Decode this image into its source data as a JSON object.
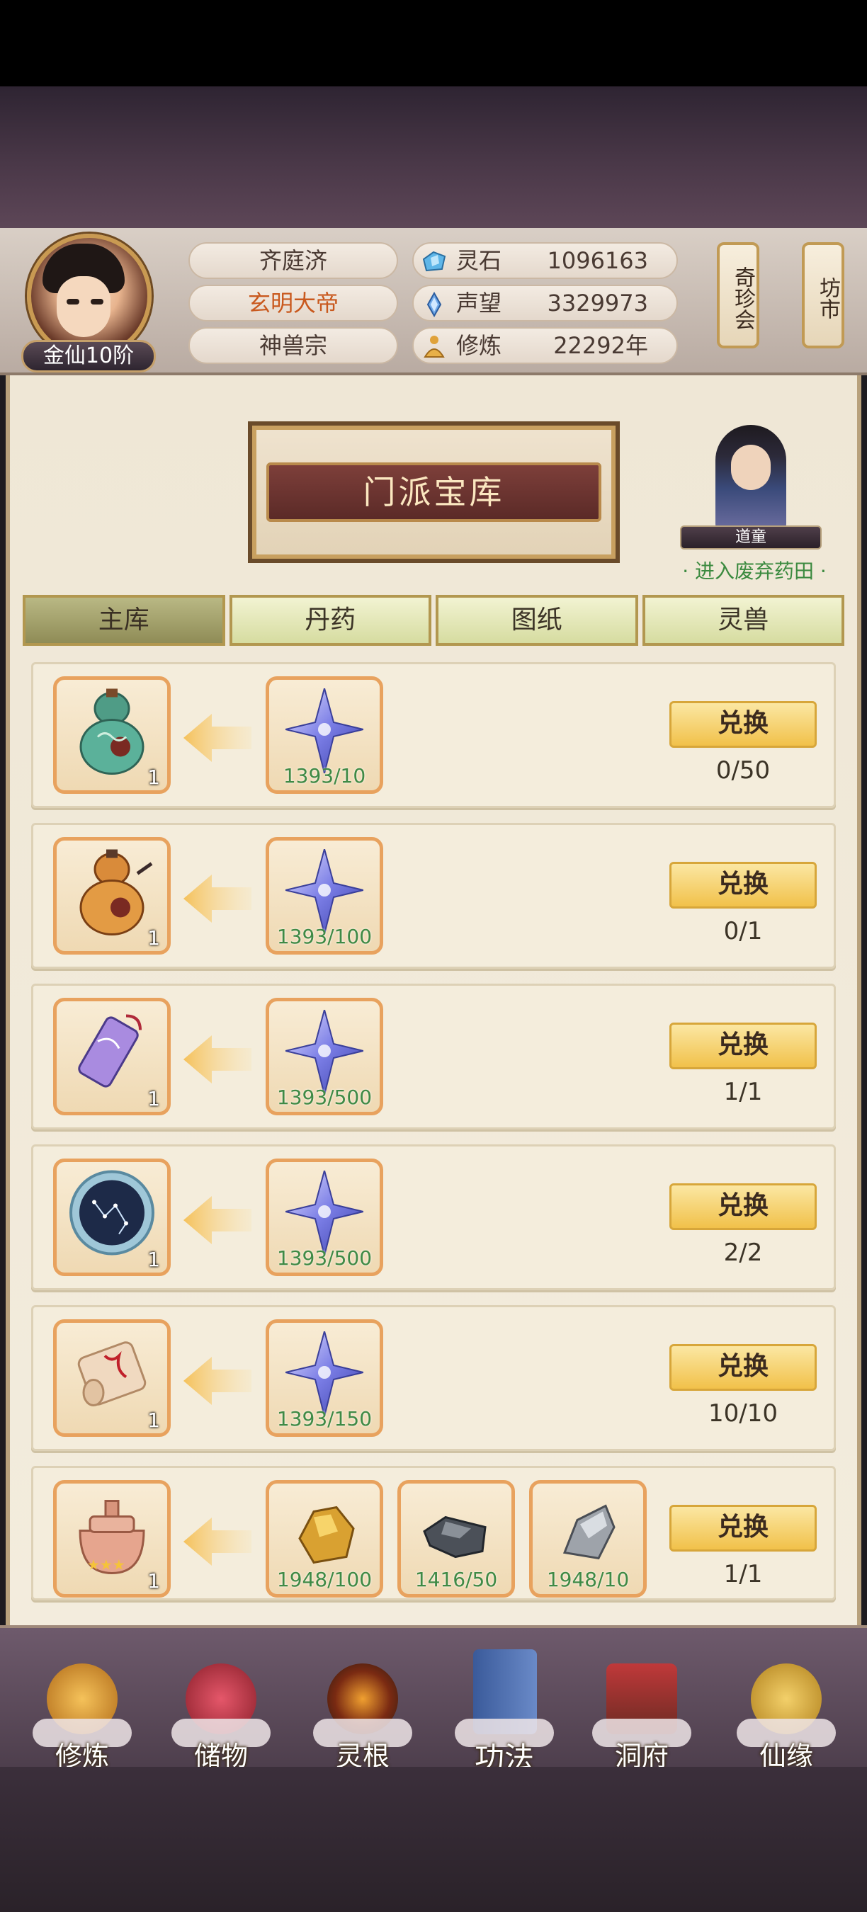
{
  "player": {
    "rank": "金仙10阶",
    "name": "齐庭济",
    "title": "玄明大帝",
    "sect": "神兽宗"
  },
  "resources": [
    {
      "icon": "spirit-stone-icon",
      "label": "灵石",
      "value": "1096163"
    },
    {
      "icon": "prestige-icon",
      "label": "声望",
      "value": "3329973"
    },
    {
      "icon": "cultivation-icon",
      "label": "修炼",
      "value": "22292年"
    }
  ],
  "side_buttons": {
    "treasure_fair": "奇珍会",
    "market": "坊市"
  },
  "page": {
    "title": "门派宝库",
    "npc_name": "道童",
    "npc_link": "· 进入废弃药田 ·"
  },
  "tabs": [
    "主库",
    "丹药",
    "图纸",
    "灵兽"
  ],
  "rows": [
    {
      "reward": "green-gourd-icon",
      "reward_count": "1",
      "costs": [
        {
          "icon": "purple-star-shard-icon",
          "qty": "1393/10"
        }
      ],
      "button": "兑换",
      "progress": "0/50"
    },
    {
      "reward": "orange-gourd-icon",
      "reward_count": "1",
      "costs": [
        {
          "icon": "purple-star-shard-icon",
          "qty": "1393/100"
        }
      ],
      "button": "兑换",
      "progress": "0/1"
    },
    {
      "reward": "purple-talisman-icon",
      "reward_count": "1",
      "costs": [
        {
          "icon": "purple-star-shard-icon",
          "qty": "1393/500"
        }
      ],
      "button": "兑换",
      "progress": "1/1"
    },
    {
      "reward": "star-chart-icon",
      "reward_count": "1",
      "costs": [
        {
          "icon": "purple-star-shard-icon",
          "qty": "1393/500"
        }
      ],
      "button": "兑换",
      "progress": "2/2"
    },
    {
      "reward": "scroll-icon",
      "reward_count": "1",
      "costs": [
        {
          "icon": "purple-star-shard-icon",
          "qty": "1393/150"
        }
      ],
      "button": "兑换",
      "progress": "10/10"
    },
    {
      "reward": "bronze-cauldron-icon",
      "reward_count": "1",
      "costs": [
        {
          "icon": "gold-ore-icon",
          "qty": "1948/100"
        },
        {
          "icon": "dark-ore-icon",
          "qty": "1416/50"
        },
        {
          "icon": "silver-ore-icon",
          "qty": "1948/10"
        }
      ],
      "button": "兑换",
      "progress": "1/1"
    }
  ],
  "bottom_nav": [
    "修炼",
    "储物",
    "灵根",
    "功法",
    "洞府",
    "仙缘"
  ],
  "colors": {
    "exchange_button": "#f1c14a",
    "slot_border": "#e8a25e",
    "qty_text": "#3f8a45",
    "active_tab": "#8f8c56"
  }
}
